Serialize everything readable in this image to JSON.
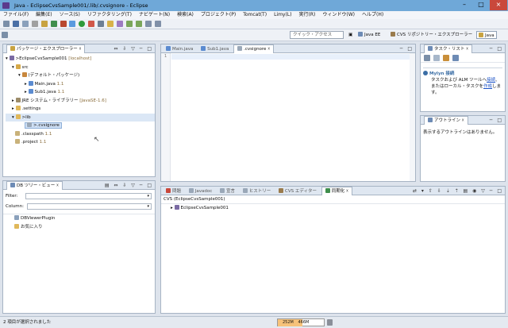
{
  "window": {
    "title": "Java - EclipseCvsSample001/.lib/.cvsignore - Eclipse"
  },
  "menu": [
    "ファイル(F)",
    "編集(E)",
    "ソース(S)",
    "リファクタリング(T)",
    "ナビゲート(N)",
    "検索(A)",
    "プロジェクト(P)",
    "Tomcat(T)",
    "Limy(L)",
    "実行(R)",
    "ウィンドウ(W)",
    "ヘルプ(H)"
  ],
  "quick_access": {
    "placeholder": "クイック・アクセス"
  },
  "perspectives": [
    "Java EE",
    "CVS リポジトリー・エクスプローラー",
    "Java"
  ],
  "package_explorer": {
    "title": "パッケージ・エクスプローラー",
    "project": ">EclipseCvsSample001",
    "project_decor": "[localhost]",
    "src": "src",
    "default_package": "(デフォルト・パッケージ)",
    "file1": "Main.java",
    "file1_rev": "1.1",
    "file2": "Sub1.java",
    "file2_rev": "1.1",
    "jre": "JRE システム・ライブラリー",
    "jre_decor": "[JavaSE-1.6]",
    "settings": ".settings",
    "lib": ">lib",
    "cvsignore": ">.cvsignore",
    "classpath": ".classpath",
    "classpath_rev": "1.1",
    "project_file": ".project",
    "project_rev": "1.1"
  },
  "editor": {
    "tabs": [
      "Main.java",
      "Sub1.java",
      ".cvsignore"
    ],
    "line_number": "1"
  },
  "task_list": {
    "title": "タスク・リスト",
    "mylyn_title": "Mylyn 接続",
    "mylyn_text1": "タスクおよび ALM ツールへ",
    "mylyn_link1": "接続",
    "mylyn_text2": "、またはローカル・タスクを",
    "mylyn_link2": "作成",
    "mylyn_text3": "します。"
  },
  "outline": {
    "title": "アウトライン",
    "message": "表示するアウトラインはありません。"
  },
  "db_tree": {
    "title": "DB ツリー・ビュー",
    "filter_label": "Filter:",
    "column_label": "Column:",
    "item1": "DBViewerPlugin",
    "item2": "お気に入り"
  },
  "bottom": {
    "tabs": [
      "問題",
      "Javadoc",
      "宣言",
      "ヒストリー",
      "CVS エディター",
      "同期化"
    ],
    "header": "CVS (EclipseCvsSample001)",
    "item": "EclipseCvsSample001"
  },
  "status": {
    "message": "2 項目が選択されました",
    "heap_used": "252M",
    "heap_total": "466M",
    "heap_fraction": 0.54
  },
  "colors": {
    "titlebar": "#6fa8d8",
    "accent": "#3b6ea5",
    "decor": "#8a6d3b"
  }
}
